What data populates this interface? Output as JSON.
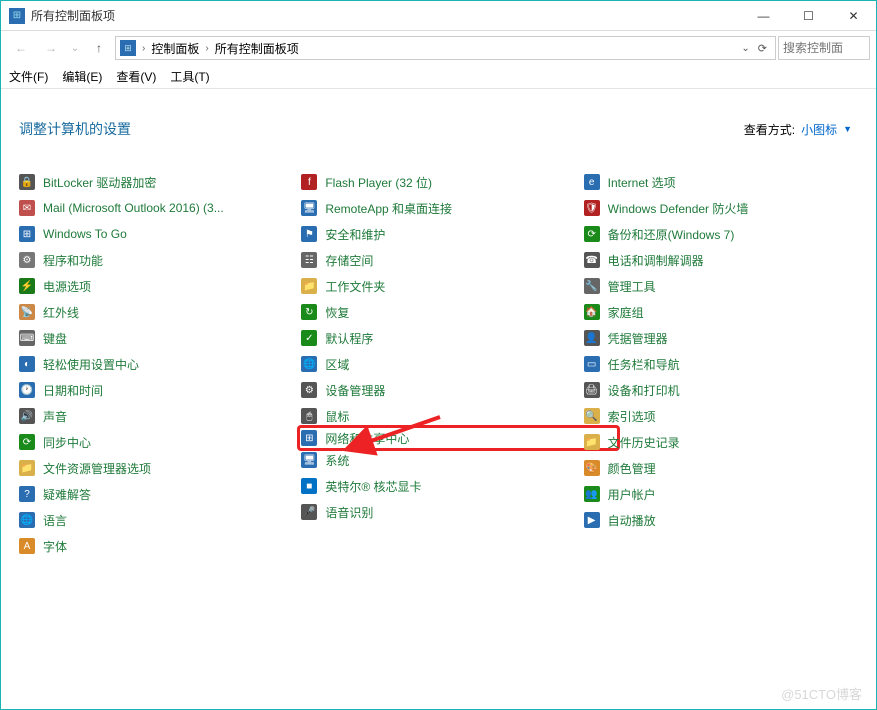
{
  "window": {
    "title": "所有控制面板项",
    "min": "—",
    "max": "☐",
    "close": "✕"
  },
  "nav": {
    "back": "←",
    "forward": "→",
    "dropdown": "⌄",
    "up": "↑",
    "refresh": "⟳"
  },
  "breadcrumb": {
    "seg1": "控制面板",
    "seg2": "所有控制面板项"
  },
  "search": {
    "placeholder": "搜索控制面板"
  },
  "menu": {
    "file": "文件(F)",
    "edit": "编辑(E)",
    "view": "查看(V)",
    "tools": "工具(T)"
  },
  "heading": "调整计算机的设置",
  "viewby": {
    "label": "查看方式:",
    "value": "小图标"
  },
  "col1": [
    {
      "icon": "🔒",
      "bg": "#555",
      "name": "bitlocker",
      "label": "BitLocker 驱动器加密"
    },
    {
      "icon": "✉",
      "bg": "#c0504d",
      "name": "mail",
      "label": "Mail (Microsoft Outlook 2016) (3..."
    },
    {
      "icon": "⊞",
      "bg": "#2a6db1",
      "name": "windows-to-go",
      "label": "Windows To Go"
    },
    {
      "icon": "⚙",
      "bg": "#777",
      "name": "programs",
      "label": "程序和功能"
    },
    {
      "icon": "⚡",
      "bg": "#1a7a1a",
      "name": "power",
      "label": "电源选项"
    },
    {
      "icon": "📡",
      "bg": "#c84",
      "name": "infrared",
      "label": "红外线"
    },
    {
      "icon": "⌨",
      "bg": "#666",
      "name": "keyboard",
      "label": "键盘"
    },
    {
      "icon": "◐",
      "bg": "#2a6db1",
      "name": "ease-of-access",
      "label": "轻松使用设置中心"
    },
    {
      "icon": "🕐",
      "bg": "#2a6db1",
      "name": "datetime",
      "label": "日期和时间"
    },
    {
      "icon": "🔊",
      "bg": "#555",
      "name": "sound",
      "label": "声音"
    },
    {
      "icon": "⟳",
      "bg": "#1a8a1a",
      "name": "sync",
      "label": "同步中心"
    },
    {
      "icon": "📁",
      "bg": "#d9b04a",
      "name": "explorer-options",
      "label": "文件资源管理器选项"
    },
    {
      "icon": "?",
      "bg": "#2a6db1",
      "name": "troubleshoot",
      "label": "疑难解答"
    },
    {
      "icon": "🌐",
      "bg": "#2a6db1",
      "name": "language",
      "label": "语言"
    },
    {
      "icon": "A",
      "bg": "#d98b2a",
      "name": "fonts",
      "label": "字体"
    }
  ],
  "col2": [
    {
      "icon": "f",
      "bg": "#b22222",
      "name": "flash",
      "label": "Flash Player (32 位)"
    },
    {
      "icon": "🖥",
      "bg": "#2a6db1",
      "name": "remoteapp",
      "label": "RemoteApp 和桌面连接"
    },
    {
      "icon": "⚑",
      "bg": "#2a6db1",
      "name": "security",
      "label": "安全和维护"
    },
    {
      "icon": "☷",
      "bg": "#666",
      "name": "storage",
      "label": "存储空间"
    },
    {
      "icon": "📁",
      "bg": "#d9b04a",
      "name": "workfolders",
      "label": "工作文件夹"
    },
    {
      "icon": "↻",
      "bg": "#1a8a1a",
      "name": "recovery",
      "label": "恢复"
    },
    {
      "icon": "✓",
      "bg": "#1a8a1a",
      "name": "default-programs",
      "label": "默认程序"
    },
    {
      "icon": "🌐",
      "bg": "#2a6db1",
      "name": "region",
      "label": "区域"
    },
    {
      "icon": "⚙",
      "bg": "#555",
      "name": "device-manager",
      "label": "设备管理器"
    },
    {
      "icon": "🖱",
      "bg": "#555",
      "name": "mouse",
      "label": "鼠标"
    },
    {
      "icon": "⊞",
      "bg": "#2a6db1",
      "name": "network-sharing",
      "label": "网络和共享中心",
      "hl": true
    },
    {
      "icon": "🖥",
      "bg": "#2a6db1",
      "name": "system",
      "label": "系统"
    },
    {
      "icon": "■",
      "bg": "#0071c5",
      "name": "intel-graphics",
      "label": "英特尔® 核芯显卡"
    },
    {
      "icon": "🎤",
      "bg": "#555",
      "name": "speech",
      "label": "语音识别"
    }
  ],
  "col3": [
    {
      "icon": "e",
      "bg": "#2a6db1",
      "name": "internet-options",
      "label": "Internet 选项"
    },
    {
      "icon": "🛡",
      "bg": "#b22222",
      "name": "defender-firewall",
      "label": "Windows Defender 防火墙"
    },
    {
      "icon": "⟳",
      "bg": "#1a8a1a",
      "name": "backup-win7",
      "label": "备份和还原(Windows 7)"
    },
    {
      "icon": "☎",
      "bg": "#555",
      "name": "phone-modem",
      "label": "电话和调制解调器"
    },
    {
      "icon": "🔧",
      "bg": "#666",
      "name": "admin-tools",
      "label": "管理工具"
    },
    {
      "icon": "🏠",
      "bg": "#1a8a1a",
      "name": "homegroup",
      "label": "家庭组"
    },
    {
      "icon": "👤",
      "bg": "#555",
      "name": "credential-manager",
      "label": "凭据管理器"
    },
    {
      "icon": "▭",
      "bg": "#2a6db1",
      "name": "taskbar",
      "label": "任务栏和导航"
    },
    {
      "icon": "🖨",
      "bg": "#555",
      "name": "devices-printers",
      "label": "设备和打印机"
    },
    {
      "icon": "🔍",
      "bg": "#d9b04a",
      "name": "indexing",
      "label": "索引选项"
    },
    {
      "icon": "📁",
      "bg": "#d9b04a",
      "name": "file-history",
      "label": "文件历史记录"
    },
    {
      "icon": "🎨",
      "bg": "#d98b2a",
      "name": "color-management",
      "label": "颜色管理"
    },
    {
      "icon": "👥",
      "bg": "#1a8a1a",
      "name": "user-accounts",
      "label": "用户帐户"
    },
    {
      "icon": "▶",
      "bg": "#2a6db1",
      "name": "autoplay",
      "label": "自动播放"
    }
  ],
  "watermark": "@51CTO博客"
}
